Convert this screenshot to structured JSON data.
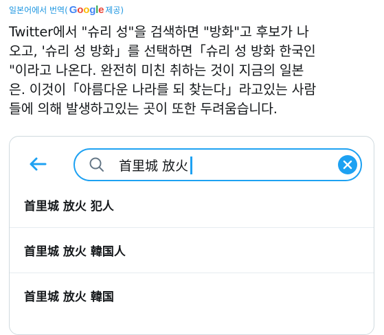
{
  "translation_attribution": {
    "prefix": "일본어에서 번역(",
    "brand": "Google",
    "suffix": " 제공)"
  },
  "translated_text": "Twitter에서 \"슈리 성\"을 검색하면 \"방화\"고 후보가 나\n오고, '슈리 성 방화」를 선택하면「슈리 성 방화 한국인\n\"이라고 나온다. 완전히 미친 취하는 것이 지금의 일본\n은. 이것이「아름다운 나라를 되 찾는다」라고있는 사람\n들에 의해 발생하고있는 곳이 또한 두려움습니다.",
  "google_colors": [
    "#4285F4",
    "#EA4335",
    "#FBBC05",
    "#4285F4",
    "#34A853",
    "#EA4335"
  ],
  "search": {
    "back_icon": "arrow-left-icon",
    "search_icon": "magnifier-icon",
    "query": "首里城 放火",
    "clear_icon": "close-circle-icon",
    "accent_color": "#1da1f2"
  },
  "suggestions": [
    {
      "label": "首里城 放火 犯人"
    },
    {
      "label": "首里城 放火 韓国人"
    },
    {
      "label": "首里城 放火 韓国"
    }
  ]
}
